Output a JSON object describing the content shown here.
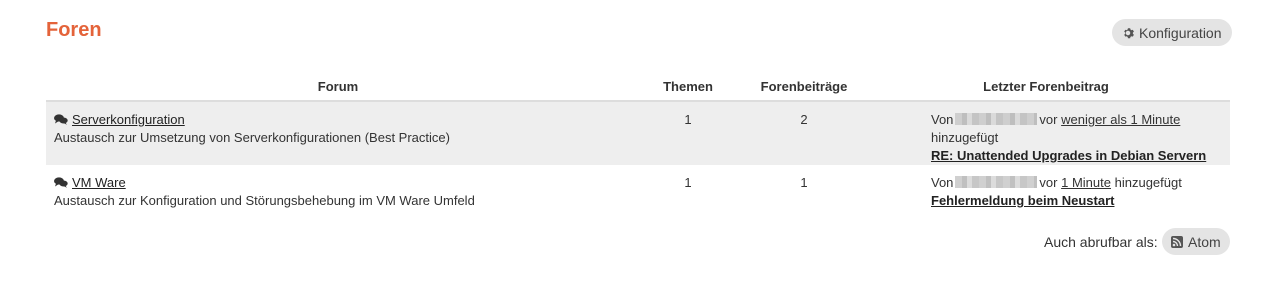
{
  "page": {
    "title": "Foren",
    "config_label": "Konfiguration"
  },
  "table": {
    "headers": {
      "forum": "Forum",
      "themen": "Themen",
      "beitraege": "Forenbeiträge",
      "letzter": "Letzter Forenbeitrag"
    },
    "rows": [
      {
        "name": "Serverkonfiguration",
        "description": "Austausch zur Umsetzung von Serverkonfigurationen (Best Practice)",
        "themen": "1",
        "beitraege": "2",
        "von": "Von",
        "vor": "vor",
        "time": "weniger als 1 Minute",
        "suffix": "hinzugefügt",
        "topic": "RE: Unattended Upgrades in Debian Servern"
      },
      {
        "name": "VM Ware",
        "description": "Austausch zur Konfiguration und Störungsbehebung im VM Ware Umfeld",
        "themen": "1",
        "beitraege": "1",
        "von": "Von",
        "vor": "vor",
        "time": "1 Minute",
        "suffix": "hinzugefügt",
        "topic": "Fehlermeldung beim Neustart"
      }
    ]
  },
  "footer": {
    "also_label": "Auch abrufbar als:",
    "atom_label": "Atom"
  },
  "icons": {
    "config": "gear-icon",
    "forum": "speech-bubbles-icon",
    "feed": "rss-feed-icon"
  },
  "colors": {
    "title": "#e4633a",
    "button_bg": "#e4e4e4",
    "row_alt": "#eeeeee"
  }
}
